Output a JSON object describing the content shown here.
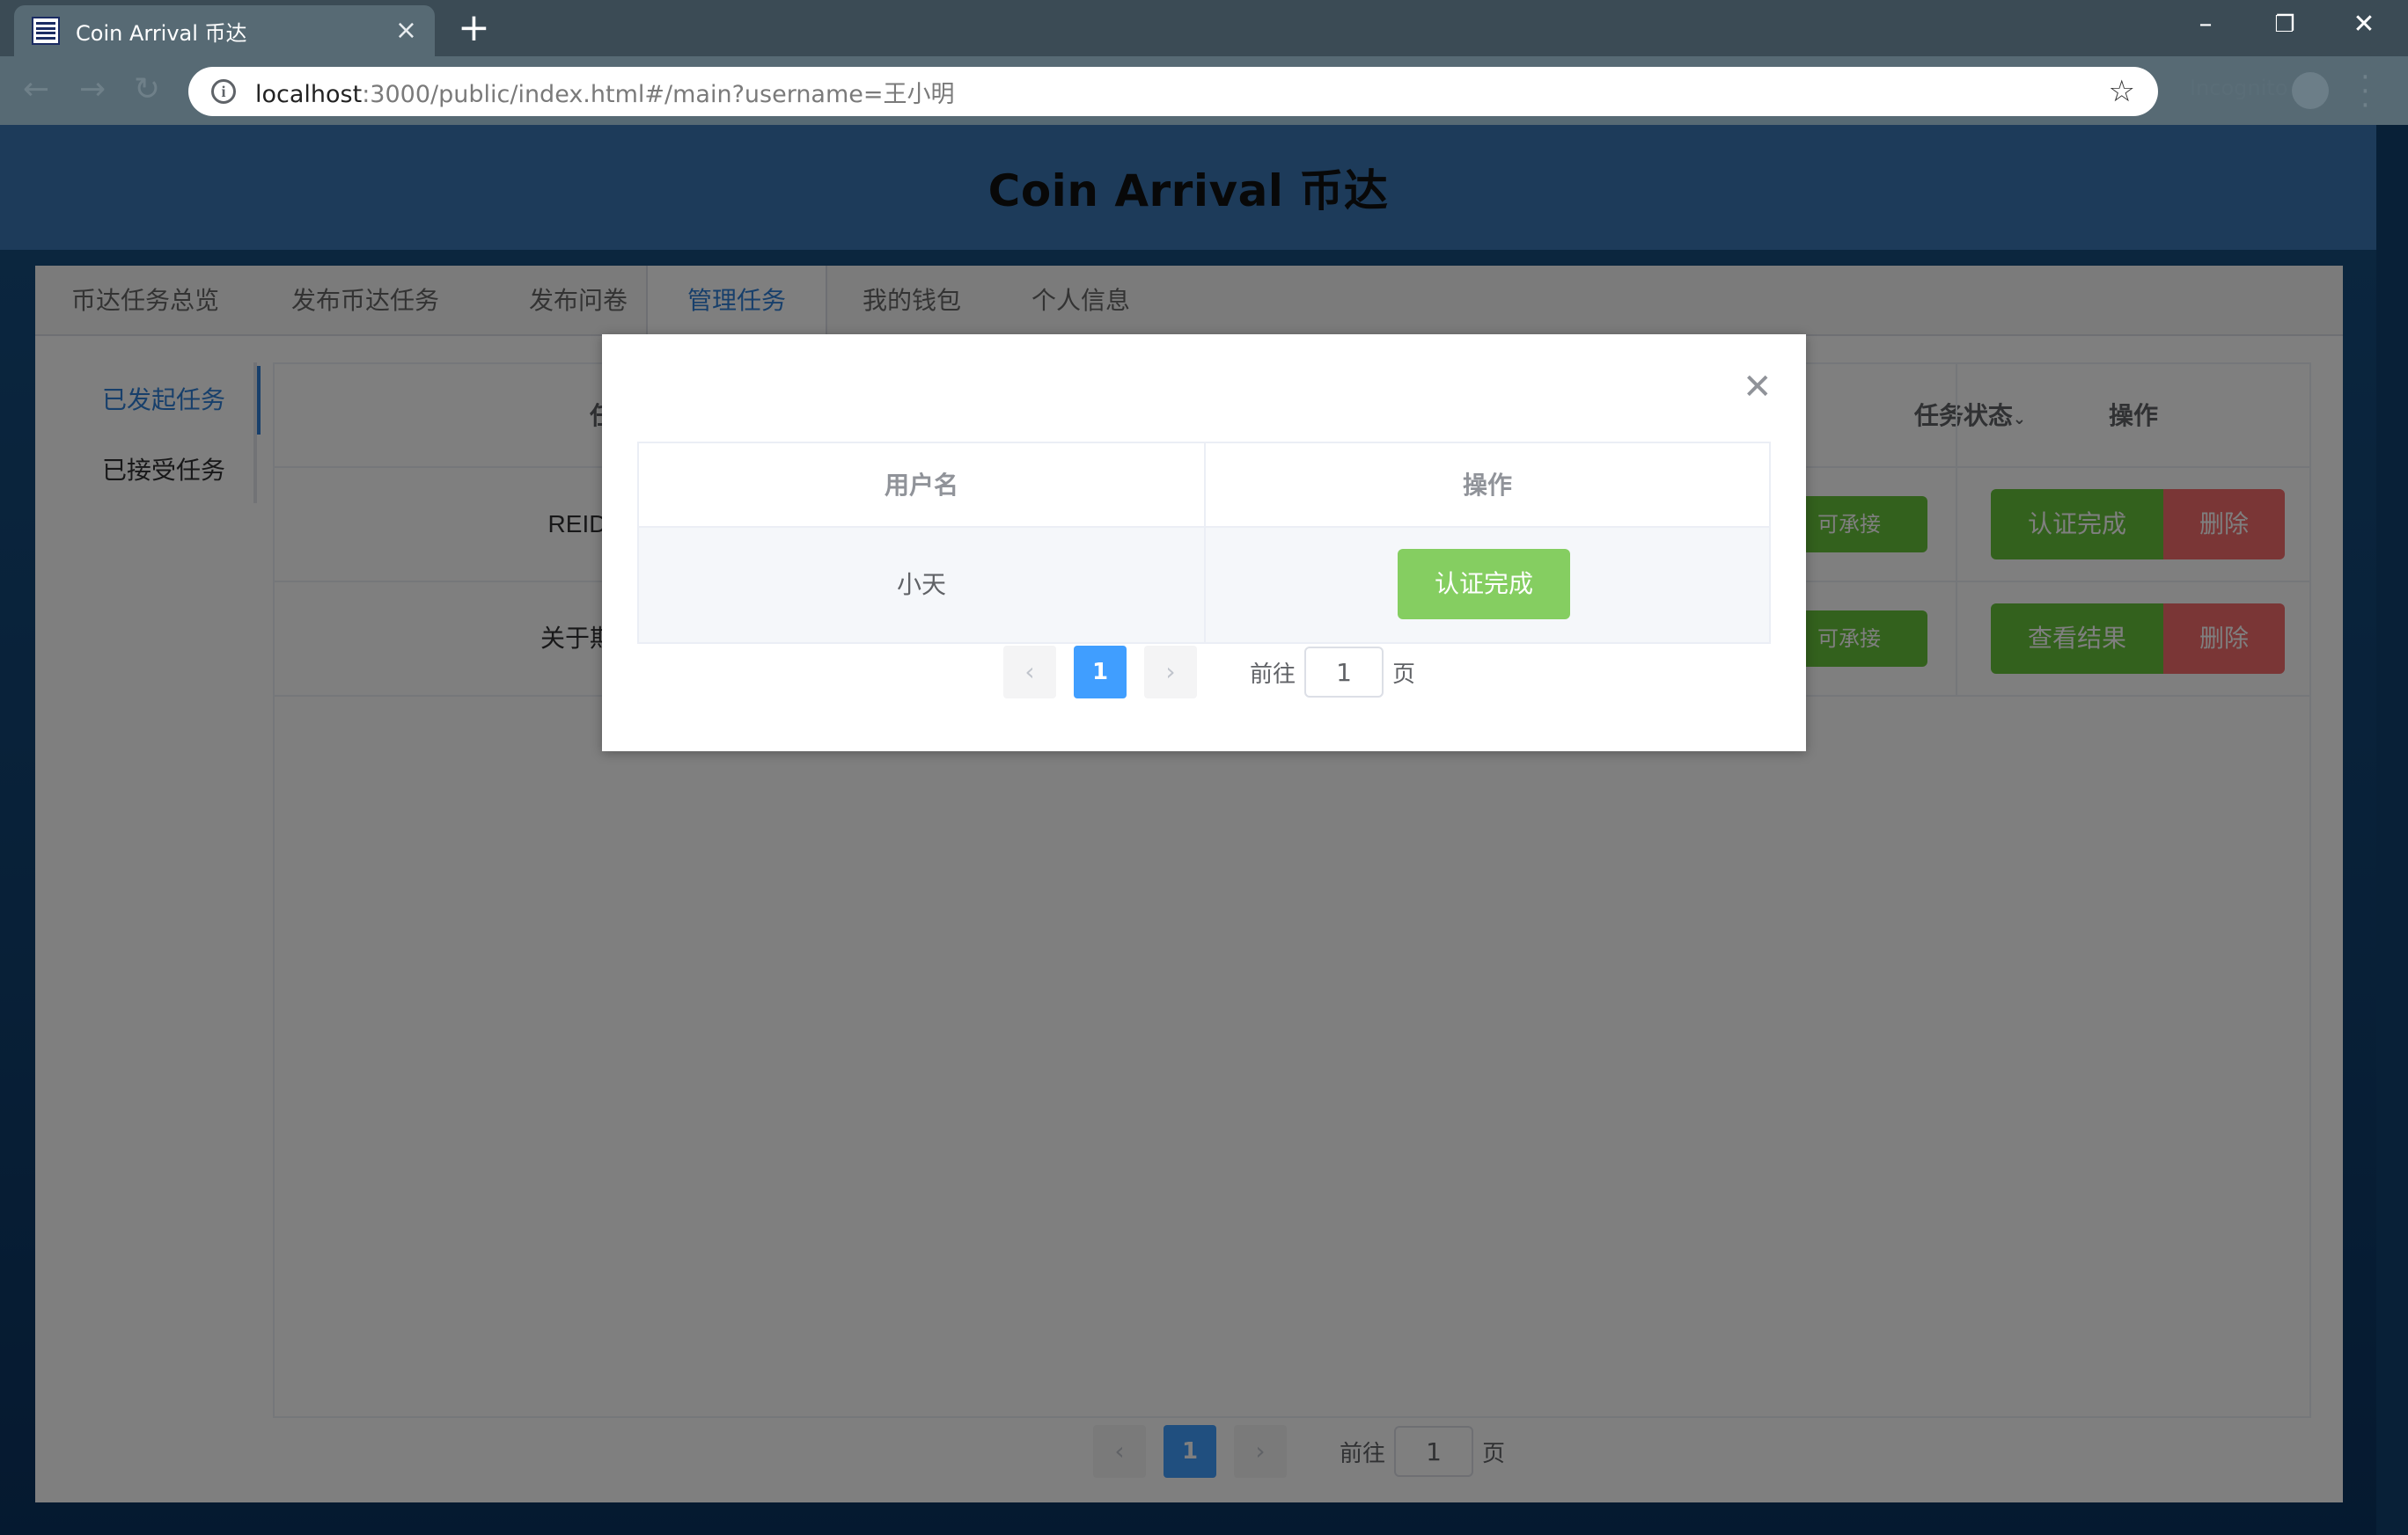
{
  "browser": {
    "tab_title": "Coin Arrival 币达",
    "new_tab": "+",
    "url_host": "localhost",
    "url_rest": ":3000/public/index.html#/main?username=王小明",
    "incognito": "Incognito",
    "window": {
      "minimize": "–",
      "restore": "❐",
      "close": "✕"
    }
  },
  "app": {
    "title": "Coin Arrival 币达"
  },
  "nav_tabs": [
    {
      "label": "币达任务总览"
    },
    {
      "label": "发布币达任务"
    },
    {
      "label": "发布问卷"
    },
    {
      "label": "管理任务",
      "active": true
    },
    {
      "label": "我的钱包"
    },
    {
      "label": "个人信息"
    }
  ],
  "sidebar": {
    "items": [
      {
        "label": "已发起任务",
        "active": true
      },
      {
        "label": "已接受任务"
      }
    ]
  },
  "task_table": {
    "headers": {
      "name": "任务名",
      "status": "任务状态",
      "actions": "操作"
    },
    "rows": [
      {
        "name": "REID数据集…",
        "status": "可承接",
        "primary": "认证完成",
        "delete": "删除"
      },
      {
        "name": "关于期末考试…",
        "status": "可承接",
        "primary": "查看结果",
        "delete": "删除"
      }
    ]
  },
  "pager": {
    "prev": "‹",
    "next": "›",
    "current": "1",
    "goto": "前往",
    "goto_value": "1",
    "unit": "页"
  },
  "dialog": {
    "headers": {
      "username": "用户名",
      "action": "操作"
    },
    "rows": [
      {
        "username": "小天",
        "action": "认证完成"
      }
    ],
    "pager": {
      "prev": "‹",
      "next": "›",
      "current": "1",
      "goto": "前往",
      "goto_value": "1",
      "unit": "页"
    }
  },
  "colors": {
    "primary": "#409eff",
    "success": "#67c23a",
    "danger": "#f56c6c",
    "header": "#3a77b4"
  }
}
